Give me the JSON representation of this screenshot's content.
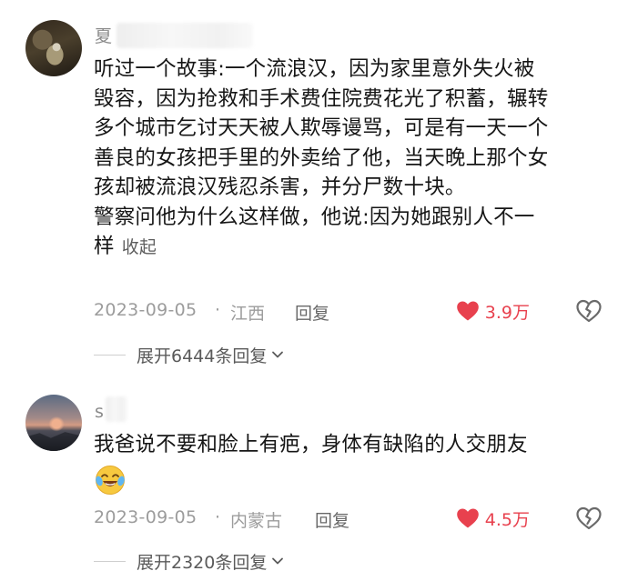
{
  "comments": [
    {
      "username": "夏",
      "text_lines": [
        "听过一个故事:一个流浪汉，因为家里意外失火被",
        "毁容，因为抢救和手术费住院费花光了积蓄，辗转",
        "多个城市乞讨天天被人欺辱谩骂，可是有一天一个",
        "善良的女孩把手里的外卖给了他，当天晚上那个女",
        "孩却被流浪汉残忍杀害，并分尸数十块。",
        "警察问他为什么这样做，他说:因为她跟别人不一",
        "样"
      ],
      "collapse_label": "收起",
      "date": "2023-09-05",
      "separator": "·",
      "region": "江西",
      "reply_label": "回复",
      "likes": "3.9万",
      "expand_label": "展开6444条回复"
    },
    {
      "username": "s",
      "text_lines": [
        "我爸说不要和脸上有疤，身体有缺陷的人交朋友"
      ],
      "date": "2023-09-05",
      "separator": "·",
      "region": "内蒙古",
      "reply_label": "回复",
      "likes": "4.5万",
      "expand_label": "展开2320条回复"
    }
  ],
  "icons": {
    "like": "heart-filled-icon",
    "dislike": "broken-heart-icon",
    "expand": "chevron-down-icon",
    "emoji": "crying-laughing-emoji-icon"
  },
  "colors": {
    "like_red": "#e8414e",
    "meta_gray": "#9c9c9c",
    "text": "#161616"
  }
}
